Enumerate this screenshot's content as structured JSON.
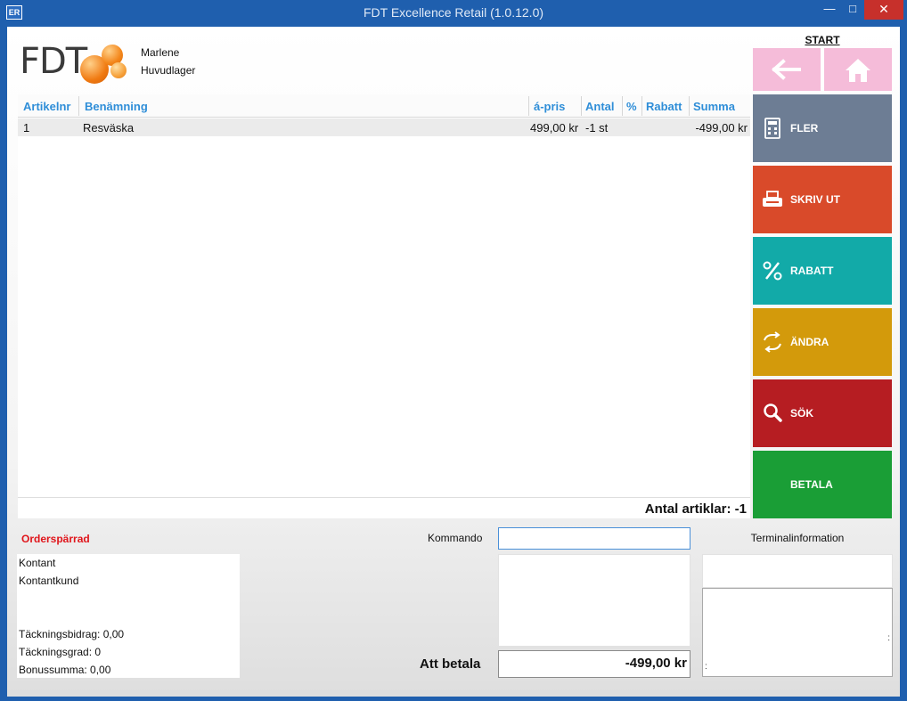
{
  "window": {
    "app_icon_text": "ER",
    "title": "FDT Excellence Retail (1.0.12.0)",
    "minimize_glyph": "—",
    "maximize_glyph": "□",
    "close_glyph": "✕"
  },
  "header": {
    "logo_text": "FDT",
    "user": "Marlene",
    "store": "Huvudlager"
  },
  "grid": {
    "columns": [
      "Artikelnr",
      "Benämning",
      "á-pris",
      "Antal",
      "%",
      "Rabatt",
      "Summa"
    ],
    "rows": [
      {
        "artikelnr": "1",
        "benamning": "Resväska",
        "apris": "499,00 kr",
        "antal": "-1 st",
        "procent": "",
        "rabatt": "",
        "summa": "-499,00 kr"
      }
    ],
    "count_text": "Antal artiklar: -1"
  },
  "nav": {
    "start_label": "START"
  },
  "tiles": [
    {
      "label": "FLER",
      "icon": "calculator-icon",
      "color": "#6d7d94"
    },
    {
      "label": "SKRIV UT",
      "icon": "printer-icon",
      "color": "#d94a2a"
    },
    {
      "label": "RABATT",
      "icon": "percent-icon",
      "color": "#12aaa8"
    },
    {
      "label": "ÄNDRA",
      "icon": "swap-arrows-icon",
      "color": "#d39a0b"
    },
    {
      "label": "SÖK",
      "icon": "magnifier-icon",
      "color": "#b61d22"
    },
    {
      "label": "BETALA",
      "icon": "",
      "color": "#1a9e36"
    }
  ],
  "customer": {
    "status": "Orderspärrad",
    "payment": "Kontant",
    "customer_type": "Kontantkund",
    "tackningsbidrag": "Täckningsbidrag: 0,00",
    "tackningsgrad": "Täckningsgrad: 0",
    "bonussumma": "Bonussumma: 0,00"
  },
  "command": {
    "label": "Kommando",
    "value": "",
    "pay_label": "Att betala",
    "pay_value": "-499,00 kr"
  },
  "terminal": {
    "label": "Terminalinformation",
    "mark_left": ":",
    "mark_right": ":"
  }
}
